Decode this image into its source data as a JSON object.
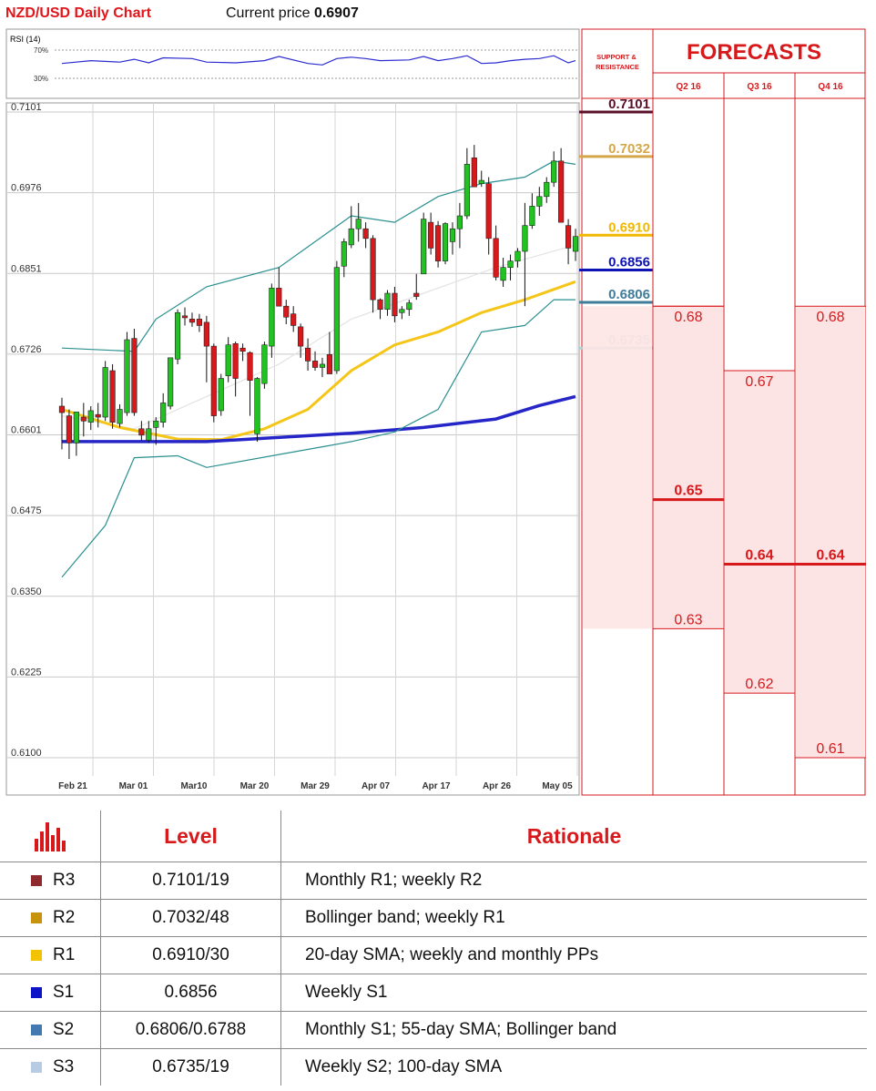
{
  "header": {
    "title": "NZD/USD Daily Chart",
    "current_price_label": "Current price",
    "current_price": "0.6907"
  },
  "rsi_panel": {
    "label": "RSI (14)",
    "upper_level": "70%",
    "lower_level": "30%"
  },
  "chart_data": [
    {
      "type": "candlestick",
      "title": "NZD/USD Daily Chart",
      "ylim": [
        0.61,
        0.7101
      ],
      "y_ticks": [
        "0.7101",
        "0.6976",
        "0.6851",
        "0.6726",
        "0.6601",
        "0.6475",
        "0.6350",
        "0.6225",
        "0.6100"
      ],
      "x_ticks": [
        "Feb 21",
        "Mar 01",
        "Mar10",
        "Mar 20",
        "Mar 29",
        "Apr 07",
        "Apr 17",
        "Apr 26",
        "May 05"
      ],
      "candles": [
        [
          0.6645,
          0.6658,
          0.6578,
          0.6635
        ],
        [
          0.663,
          0.664,
          0.6563,
          0.6588
        ],
        [
          0.6588,
          0.6622,
          0.6568,
          0.6636
        ],
        [
          0.6628,
          0.665,
          0.6598,
          0.6622
        ],
        [
          0.662,
          0.6645,
          0.6608,
          0.6638
        ],
        [
          0.6632,
          0.665,
          0.6612,
          0.6628
        ],
        [
          0.6628,
          0.6715,
          0.6622,
          0.6705
        ],
        [
          0.67,
          0.671,
          0.661,
          0.662
        ],
        [
          0.6618,
          0.6648,
          0.6612,
          0.664
        ],
        [
          0.6635,
          0.676,
          0.663,
          0.6748
        ],
        [
          0.675,
          0.6765,
          0.663,
          0.6635
        ],
        [
          0.661,
          0.6622,
          0.6592,
          0.66
        ],
        [
          0.6592,
          0.6622,
          0.6588,
          0.661
        ],
        [
          0.6612,
          0.6628,
          0.6585,
          0.6622
        ],
        [
          0.662,
          0.6665,
          0.6612,
          0.665
        ],
        [
          0.6645,
          0.6718,
          0.664,
          0.672
        ],
        [
          0.6718,
          0.6795,
          0.671,
          0.679
        ],
        [
          0.6785,
          0.6798,
          0.677,
          0.6782
        ],
        [
          0.678,
          0.679,
          0.6768,
          0.6775
        ],
        [
          0.678,
          0.6788,
          0.676,
          0.677
        ],
        [
          0.6775,
          0.6785,
          0.6682,
          0.6738
        ],
        [
          0.6738,
          0.6742,
          0.662,
          0.663
        ],
        [
          0.6638,
          0.6695,
          0.663,
          0.6688
        ],
        [
          0.6692,
          0.6752,
          0.6682,
          0.674
        ],
        [
          0.6742,
          0.6745,
          0.666,
          0.6688
        ],
        [
          0.6735,
          0.6742,
          0.6715,
          0.673
        ],
        [
          0.6728,
          0.673,
          0.663,
          0.6685
        ],
        [
          0.6602,
          0.669,
          0.659,
          0.6688
        ],
        [
          0.668,
          0.6745,
          0.6672,
          0.674
        ],
        [
          0.6738,
          0.6835,
          0.672,
          0.6828
        ],
        [
          0.6828,
          0.686,
          0.681,
          0.68
        ],
        [
          0.68,
          0.681,
          0.6772,
          0.6783
        ],
        [
          0.6788,
          0.68,
          0.676,
          0.677
        ],
        [
          0.6768,
          0.6773,
          0.672,
          0.6738
        ],
        [
          0.6735,
          0.675,
          0.67,
          0.6715
        ],
        [
          0.6715,
          0.673,
          0.67,
          0.6705
        ],
        [
          0.6705,
          0.672,
          0.669,
          0.671
        ],
        [
          0.6725,
          0.676,
          0.6698,
          0.6695
        ],
        [
          0.67,
          0.687,
          0.6695,
          0.686
        ],
        [
          0.6862,
          0.6905,
          0.6845,
          0.69
        ],
        [
          0.6895,
          0.6955,
          0.689,
          0.692
        ],
        [
          0.692,
          0.696,
          0.69,
          0.6935
        ],
        [
          0.692,
          0.693,
          0.689,
          0.6905
        ],
        [
          0.6905,
          0.691,
          0.679,
          0.681
        ],
        [
          0.681,
          0.6812,
          0.678,
          0.6795
        ],
        [
          0.6795,
          0.6825,
          0.6785,
          0.682
        ],
        [
          0.682,
          0.683,
          0.6775,
          0.6785
        ],
        [
          0.679,
          0.68,
          0.678,
          0.6795
        ],
        [
          0.6795,
          0.681,
          0.6785,
          0.6805
        ],
        [
          0.682,
          0.685,
          0.681,
          0.6815
        ],
        [
          0.685,
          0.6945,
          0.685,
          0.6935
        ],
        [
          0.693,
          0.6945,
          0.688,
          0.689
        ],
        [
          0.6925,
          0.6932,
          0.686,
          0.687
        ],
        [
          0.687,
          0.693,
          0.6865,
          0.6928
        ],
        [
          0.69,
          0.693,
          0.688,
          0.692
        ],
        [
          0.692,
          0.696,
          0.689,
          0.694
        ],
        [
          0.694,
          0.7045,
          0.6935,
          0.702
        ],
        [
          0.703,
          0.705,
          0.699,
          0.6985
        ],
        [
          0.699,
          0.701,
          0.6985,
          0.6995
        ],
        [
          0.699,
          0.7,
          0.688,
          0.6905
        ],
        [
          0.6905,
          0.6925,
          0.684,
          0.6845
        ],
        [
          0.684,
          0.6875,
          0.683,
          0.686
        ],
        [
          0.686,
          0.688,
          0.684,
          0.687
        ],
        [
          0.687,
          0.689,
          0.686,
          0.6885
        ],
        [
          0.6885,
          0.696,
          0.68,
          0.6925
        ],
        [
          0.6925,
          0.6975,
          0.692,
          0.6955
        ],
        [
          0.6955,
          0.6985,
          0.694,
          0.697
        ],
        [
          0.697,
          0.7,
          0.696,
          0.6992
        ],
        [
          0.6992,
          0.704,
          0.6985,
          0.7025
        ],
        [
          0.7025,
          0.7045,
          0.693,
          0.693
        ],
        [
          0.6925,
          0.6935,
          0.6865,
          0.689
        ],
        [
          0.6885,
          0.692,
          0.687,
          0.6908
        ]
      ],
      "series": [
        {
          "name": "20-day SMA",
          "color": "#e3e3e3",
          "values": [
            [
              0,
              0.663
            ],
            [
              10,
              0.661
            ],
            [
              20,
              0.666
            ],
            [
              30,
              0.671
            ],
            [
              40,
              0.678
            ],
            [
              50,
              0.682
            ],
            [
              60,
              0.686
            ],
            [
              71,
              0.6895
            ]
          ]
        },
        {
          "name": "55-day SMA",
          "color": "#f5c518",
          "values": [
            [
              0,
              0.664
            ],
            [
              8,
              0.6612
            ],
            [
              16,
              0.6594
            ],
            [
              22,
              0.6593
            ],
            [
              28,
              0.661
            ],
            [
              34,
              0.664
            ],
            [
              40,
              0.67
            ],
            [
              46,
              0.674
            ],
            [
              52,
              0.676
            ],
            [
              58,
              0.679
            ],
            [
              64,
              0.681
            ],
            [
              71,
              0.6838
            ]
          ]
        },
        {
          "name": "100-day SMA",
          "color": "#2626c8",
          "values": [
            [
              0,
              0.659
            ],
            [
              20,
              0.659
            ],
            [
              40,
              0.6603
            ],
            [
              50,
              0.6612
            ],
            [
              60,
              0.6625
            ],
            [
              66,
              0.6646
            ],
            [
              71,
              0.666
            ]
          ]
        },
        {
          "name": "Bollinger upper",
          "color": "#2a8f8f",
          "values": [
            [
              0,
              0.6735
            ],
            [
              10,
              0.673
            ],
            [
              13,
              0.678
            ],
            [
              20,
              0.683
            ],
            [
              30,
              0.686
            ],
            [
              40,
              0.694
            ],
            [
              46,
              0.693
            ],
            [
              52,
              0.697
            ],
            [
              58,
              0.699
            ],
            [
              64,
              0.7
            ],
            [
              68,
              0.7025
            ],
            [
              71,
              0.702
            ]
          ]
        },
        {
          "name": "Bollinger lower",
          "color": "#2a8f8f",
          "values": [
            [
              0,
              0.638
            ],
            [
              6,
              0.646
            ],
            [
              10,
              0.6565
            ],
            [
              16,
              0.6568
            ],
            [
              20,
              0.655
            ],
            [
              30,
              0.657
            ],
            [
              40,
              0.659
            ],
            [
              46,
              0.6605
            ],
            [
              52,
              0.664
            ],
            [
              58,
              0.676
            ],
            [
              64,
              0.677
            ],
            [
              68,
              0.681
            ],
            [
              71,
              0.681
            ]
          ]
        }
      ]
    },
    {
      "type": "line",
      "title": "RSI (14)",
      "ylim": [
        0,
        100
      ],
      "y_ticks": [
        "70%",
        "30%"
      ],
      "values": [
        [
          0,
          51
        ],
        [
          4,
          55
        ],
        [
          8,
          53
        ],
        [
          10,
          57
        ],
        [
          12,
          52
        ],
        [
          14,
          59
        ],
        [
          18,
          58
        ],
        [
          20,
          53
        ],
        [
          24,
          52
        ],
        [
          28,
          55
        ],
        [
          30,
          61
        ],
        [
          34,
          51
        ],
        [
          36,
          49
        ],
        [
          38,
          58
        ],
        [
          40,
          60
        ],
        [
          42,
          58
        ],
        [
          44,
          55
        ],
        [
          48,
          56
        ],
        [
          50,
          61
        ],
        [
          52,
          55
        ],
        [
          54,
          58
        ],
        [
          56,
          62
        ],
        [
          58,
          51
        ],
        [
          60,
          52
        ],
        [
          62,
          55
        ],
        [
          64,
          57
        ],
        [
          66,
          58
        ],
        [
          68,
          62
        ],
        [
          70,
          52
        ],
        [
          71,
          55
        ]
      ]
    }
  ],
  "support_resistance": {
    "heading": "SUPPORT & RESISTANCE",
    "levels": [
      {
        "label": "0.7101",
        "value": 0.7101,
        "color": "#5a0f2a"
      },
      {
        "label": "0.7032",
        "value": 0.7032,
        "color": "#d4a84a"
      },
      {
        "label": "0.6910",
        "value": 0.691,
        "color": "#f0b800"
      },
      {
        "label": "0.6856",
        "value": 0.6856,
        "color": "#0e13b4"
      },
      {
        "label": "0.6806",
        "value": 0.6806,
        "color": "#3f7c9a"
      },
      {
        "label": "0.6735",
        "value": 0.6735,
        "color": "#a9d2d2"
      }
    ]
  },
  "forecasts": {
    "title": "FORECASTS",
    "columns": [
      {
        "quarter": "Q2 16",
        "high": "0.68",
        "high_value": 0.68,
        "mid": "0.65",
        "mid_value": 0.65,
        "low": "0.63",
        "low_value": 0.63
      },
      {
        "quarter": "Q3 16",
        "high": "0.67",
        "high_value": 0.67,
        "mid": "0.64",
        "mid_value": 0.64,
        "low": "0.62",
        "low_value": 0.62
      },
      {
        "quarter": "Q4 16",
        "high": "0.68",
        "high_value": 0.68,
        "mid": "0.64",
        "mid_value": 0.64,
        "low": "0.61",
        "low_value": 0.61
      }
    ]
  },
  "table": {
    "col_level": "Level",
    "col_rationale": "Rationale",
    "rows": [
      {
        "tag": "R3",
        "color": "#8e2a2e",
        "level": "0.7101/19",
        "rationale": "Monthly R1; weekly R2"
      },
      {
        "tag": "R2",
        "color": "#c7930a",
        "level": "0.7032/48",
        "rationale": "Bollinger band; weekly R1"
      },
      {
        "tag": "R1",
        "color": "#f3c300",
        "level": "0.6910/30",
        "rationale": "20-day SMA; weekly and monthly PPs"
      },
      {
        "tag": "S1",
        "color": "#0d14c8",
        "level": "0.6856",
        "rationale": "Weekly S1"
      },
      {
        "tag": "S2",
        "color": "#4279b0",
        "level": "0.6806/0.6788",
        "rationale": "Monthly S1; 55-day SMA; Bollinger band"
      },
      {
        "tag": "S3",
        "color": "#b7cbe2",
        "level": "0.6735/19",
        "rationale": "Weekly S2; 100-day SMA"
      }
    ]
  }
}
